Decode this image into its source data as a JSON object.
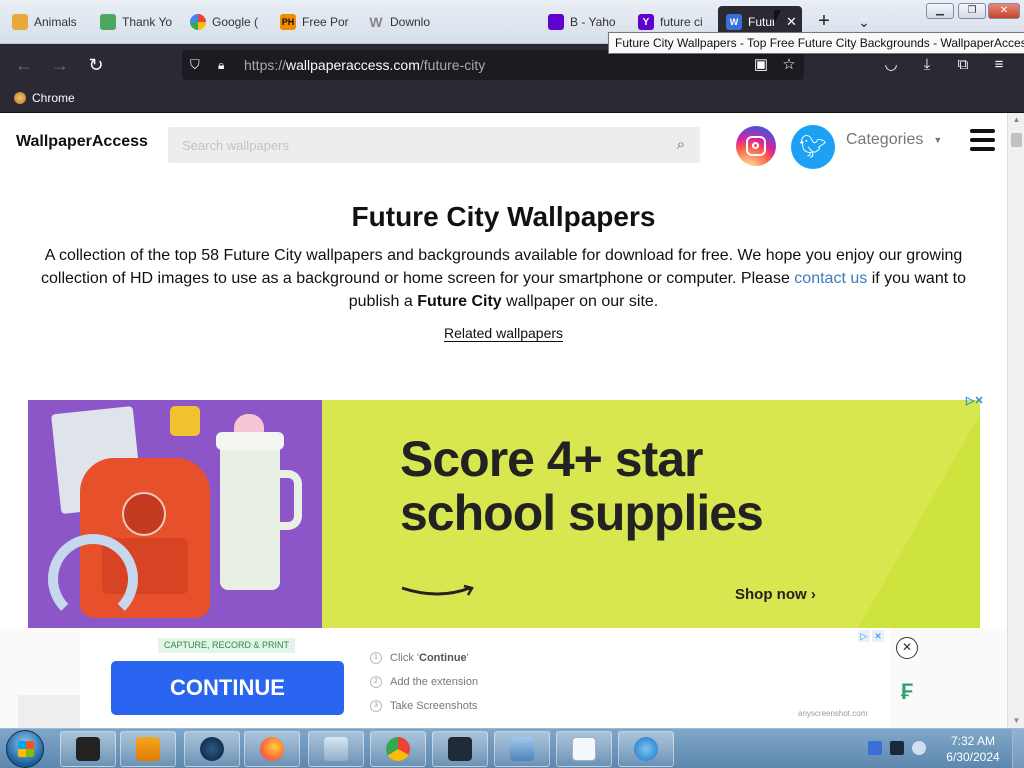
{
  "tabs": [
    {
      "label": "Animals",
      "icon_color": "#e8a93a"
    },
    {
      "label": "Thank Yo",
      "icon_color": "#4aa860"
    },
    {
      "label": "Google (",
      "icon_color": "#4285f4"
    },
    {
      "label": "Free Por",
      "icon_color": "#f08c00",
      "icon_text": "PH"
    },
    {
      "label": "Downlo",
      "icon_color": "#7a7a7a",
      "icon_text": "W"
    },
    {
      "label": "B - Yaho",
      "icon_color": "#6001d2"
    },
    {
      "label": "future ci",
      "icon_color": "#6001d2",
      "icon_text": "Y"
    },
    {
      "label": "Futur",
      "icon_color": "#3b6fd8",
      "icon_text": "W"
    }
  ],
  "tooltip": "Future City Wallpapers - Top Free Future City Backgrounds - WallpaperAccess",
  "url": {
    "scheme": "https://",
    "host": "wallpaperaccess.com",
    "path": "/future-city"
  },
  "bookmark": "Chrome",
  "site": {
    "logo": "WallpaperAccess",
    "search_placeholder": "Search wallpapers",
    "categories": "Categories"
  },
  "content": {
    "title": "Future City Wallpapers",
    "intro_part1": "A collection of the top 58 Future City wallpapers and backgrounds available for download for free. We hope you enjoy our growing collection of HD images to use as a background or home screen for your smartphone or computer. Please",
    "contact_link": "contact us",
    "intro_part2": "if you want to publish a",
    "intro_bold": "Future City",
    "intro_part3": "wallpaper on our site.",
    "related": "Related wallpapers"
  },
  "ad": {
    "headline_line1": "Score 4+ star",
    "headline_line2": "school supplies",
    "cta": "Shop now ›"
  },
  "bottom_ad": {
    "badge": "CAPTURE, RECORD & PRINT",
    "button": "CONTINUE",
    "steps": [
      {
        "num": "1",
        "text_pre": "Click '",
        "text_bold": "Continue",
        "text_post": "'"
      },
      {
        "num": "2",
        "text_pre": "Add the extension",
        "text_bold": "",
        "text_post": ""
      },
      {
        "num": "3",
        "text_pre": "Take Screenshots",
        "text_bold": "",
        "text_post": ""
      }
    ],
    "domain": "anyscreenshot.com"
  },
  "taskbar": {
    "time": "7:32 AM",
    "date": "6/30/2024"
  },
  "colors": {
    "ad_bg": "#d8e64f",
    "ad_photo_bg": "#8c56c8",
    "continue_button": "#2965f1",
    "link": "#3a7dbd",
    "browser_dark": "#2b2a33"
  }
}
